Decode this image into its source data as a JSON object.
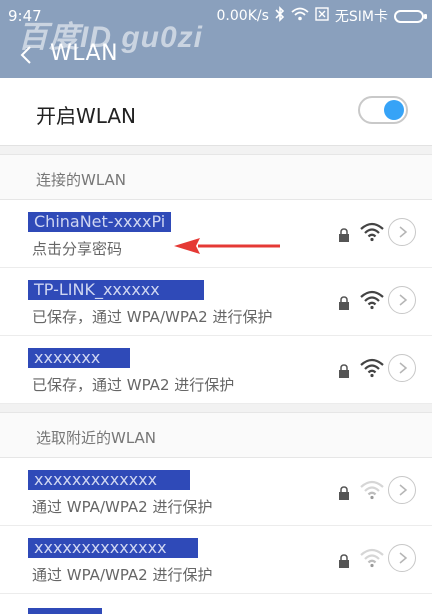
{
  "status_bar": {
    "time": "9:47",
    "speed": "0.00K/s",
    "sim": "无SIM卡"
  },
  "header": {
    "title": "WLAN",
    "watermark": "百度ID gu0zi"
  },
  "wlan_toggle": {
    "label": "开启WLAN",
    "on": true
  },
  "connected_section": {
    "label": "连接的WLAN",
    "networks": [
      {
        "ssid": "ChinaNet-xxxxPi",
        "subtitle": "点击分享密码",
        "secured": true,
        "signal": "strong"
      }
    ]
  },
  "saved_networks": [
    {
      "ssid": "TP-LINK_xxxxxx",
      "subtitle": "已保存，通过 WPA/WPA2 进行保护",
      "secured": true,
      "signal": "strong"
    },
    {
      "ssid": "xxxxxxx",
      "subtitle": "已保存，通过 WPA2 进行保护",
      "secured": true,
      "signal": "strong"
    }
  ],
  "nearby_section": {
    "label": "选取附近的WLAN",
    "networks": [
      {
        "ssid": "xxxxxxxxxxxxx",
        "subtitle": "通过 WPA/WPA2 进行保护",
        "secured": true,
        "signal": "weak"
      },
      {
        "ssid": "xxxxxxxxxxxxxx",
        "subtitle": "通过 WPA/WPA2 进行保护",
        "secured": true,
        "signal": "weak"
      }
    ]
  },
  "colors": {
    "header_bg": "#8aa0bd",
    "toggle_on": "#36a3f7",
    "redaction": "#2f4ab8",
    "arrow": "#e53935"
  }
}
